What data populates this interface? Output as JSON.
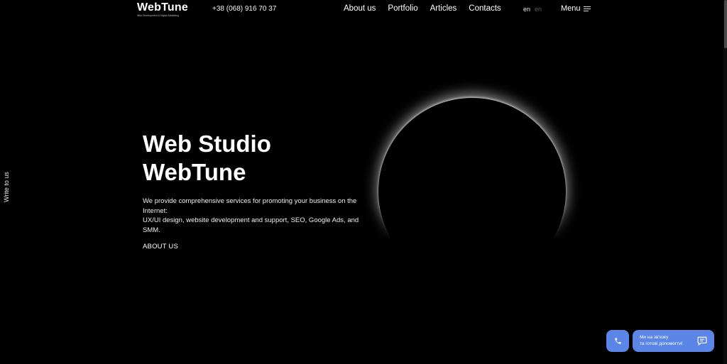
{
  "header": {
    "logo_name": "WebTune",
    "logo_tagline": "Web Development & Digital Marketing",
    "phone": "+38 (068) 916 70 37",
    "nav": [
      "About us",
      "Portfolio",
      "Articles",
      "Contacts"
    ],
    "lang_current": "en",
    "lang_other": "en",
    "menu_label": "Menu"
  },
  "side": {
    "write_to_us": "Write to us"
  },
  "hero": {
    "title_line1": "Web Studio",
    "title_line2": "WebTune",
    "desc_line1": "We provide comprehensive services for promoting your business on the Internet:",
    "desc_line2": "UX/UI design, website development and support, SEO, Google Ads, and SMM.",
    "about_link": "ABOUT US"
  },
  "widget": {
    "chat_line1": "Ми на зв'язку",
    "chat_line2": "та готові допомогти!",
    "call_icon": "phone-icon",
    "chat_icon": "chat-bubble-icon",
    "accent_color": "#5b86e8"
  }
}
